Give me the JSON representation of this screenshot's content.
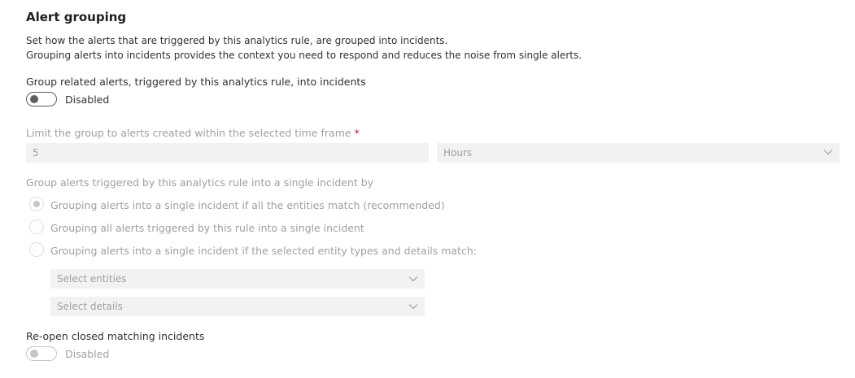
{
  "section": {
    "title": "Alert grouping",
    "description_line1": "Set how the alerts that are triggered by this analytics rule, are grouped into incidents.",
    "description_line2": "Grouping alerts into incidents provides the context you need to respond and reduces the noise from single alerts."
  },
  "group_related": {
    "label": "Group related alerts, triggered by this analytics rule, into incidents",
    "toggle_state": "Disabled"
  },
  "time_frame": {
    "label": "Limit the group to alerts created within the selected time frame",
    "required_mark": "*",
    "value": "5",
    "unit": "Hours"
  },
  "grouping_method": {
    "label": "Group alerts triggered by this analytics rule into a single incident by",
    "options": [
      {
        "label": "Grouping alerts into a single incident if all the entities match (recommended)",
        "selected": true
      },
      {
        "label": "Grouping all alerts triggered by this rule into a single incident",
        "selected": false
      },
      {
        "label": "Grouping alerts into a single incident if the selected entity types and details match:",
        "selected": false
      }
    ],
    "entities_placeholder": "Select entities",
    "details_placeholder": "Select details"
  },
  "reopen": {
    "label": "Re-open closed matching incidents",
    "toggle_state": "Disabled"
  },
  "icons": {
    "dropdown": "chevron-down-icon",
    "radio_selected": "radio-dot-icon"
  },
  "colors": {
    "disabled_text": "#a19f9d",
    "field_bg": "#f3f2f1",
    "required": "#a4262c"
  }
}
